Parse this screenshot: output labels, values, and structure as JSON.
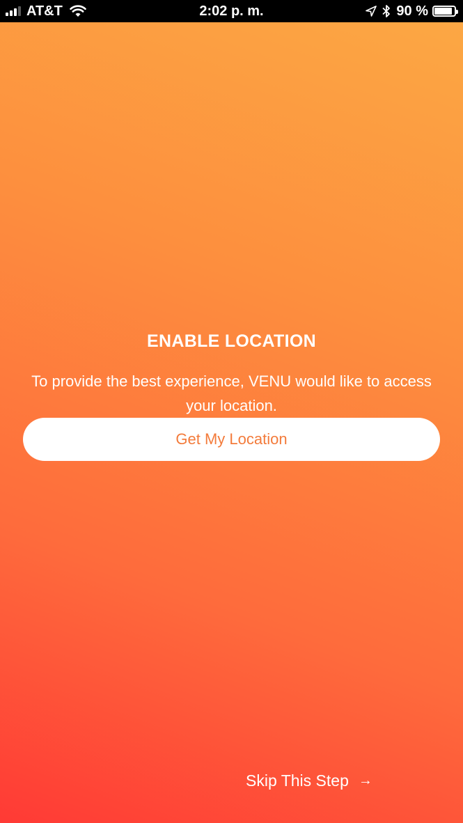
{
  "status_bar": {
    "carrier": "AT&T",
    "time": "2:02 p. m.",
    "battery_percent": "90 %",
    "battery_level": 0.9,
    "signal_bars_active": 3,
    "signal_bars_total": 4,
    "icons": [
      "signal-icon",
      "wifi-icon",
      "location-arrow-icon",
      "bluetooth-icon",
      "battery-icon"
    ]
  },
  "content": {
    "title": "ENABLE LOCATION",
    "message": "To provide the best experience, VENU would like to access your location.",
    "primary_button": "Get My Location",
    "skip_label": "Skip This Step",
    "skip_icon": "→"
  },
  "colors": {
    "gradient_top": "#fca944",
    "gradient_bottom": "#ff3a35",
    "button_text": "#f37b3b",
    "text": "#ffffff"
  }
}
